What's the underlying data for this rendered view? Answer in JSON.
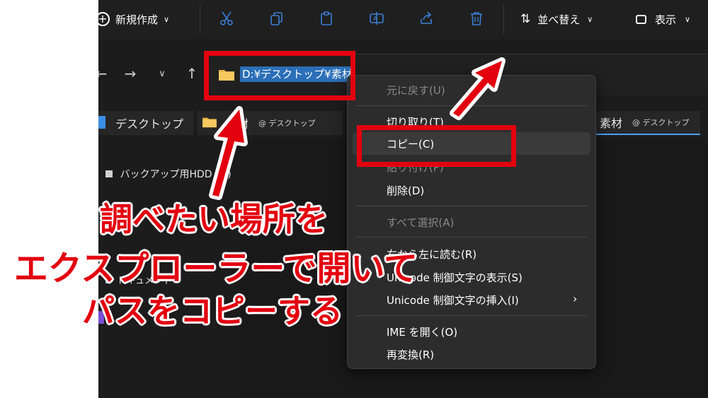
{
  "toolbar": {
    "new_label": "新規作成",
    "sort_label": "並べ替え",
    "view_label": "表示"
  },
  "address": {
    "path": "D:¥デスクトップ¥素材"
  },
  "tabs": [
    {
      "label": "デスクトップ",
      "sub": ""
    },
    {
      "label": "素材",
      "sub": "@ デスクトップ"
    },
    {
      "label": "素材",
      "sub": "@ デスクトップ"
    }
  ],
  "sidebar": {
    "items": [
      {
        "label": "バックアップ用HDD (F:)"
      },
      {
        "label": "ドキュメント"
      }
    ]
  },
  "context_menu": {
    "items": [
      {
        "label": "元に戻す(U)",
        "disabled": true
      },
      {
        "label": "切り取り(T)",
        "disabled": false
      },
      {
        "label": "コピー(C)",
        "disabled": false
      },
      {
        "label": "貼り付け(P)",
        "disabled": true
      },
      {
        "label": "削除(D)",
        "disabled": false
      },
      {
        "label": "すべて選択(A)",
        "disabled": true
      },
      {
        "label": "右から左に読む(R)",
        "disabled": false
      },
      {
        "label": "Unicode 制御文字の表示(S)",
        "disabled": false
      },
      {
        "label": "Unicode 制御文字の挿入(I)",
        "disabled": false
      },
      {
        "label": "IME を開く(O)",
        "disabled": false
      },
      {
        "label": "再変換(R)",
        "disabled": false
      }
    ]
  },
  "annotation": {
    "line1": "調べたい場所を",
    "line2": "エクスプローラーで開いて",
    "line3": "パスをコピーする"
  },
  "colors": {
    "accent_red": "#e3000f",
    "selection_blue": "#2b6fb8",
    "dark_bg": "#1c1c1c",
    "menu_bg": "#2c2c2c"
  }
}
